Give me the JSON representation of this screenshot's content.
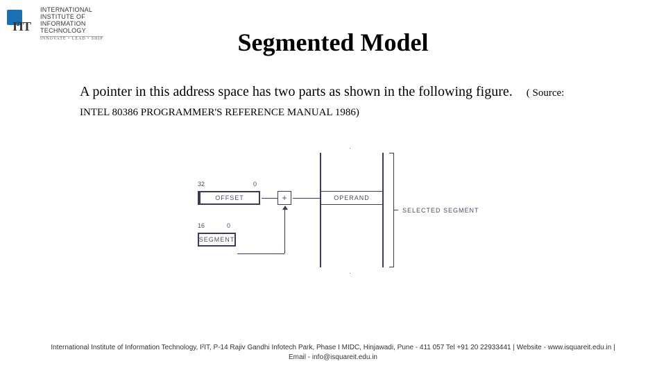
{
  "logo": {
    "line1": "International",
    "line2": "Institute of",
    "line3": "Information",
    "line4": "Technology",
    "tagline": "Innovate • Lead • Ship"
  },
  "title": "Segmented Model",
  "body": {
    "sentence": "A  pointer in this address space  has  two parts as shown in the following figure.",
    "source": "( Source: INTEL 80386 PROGRAMMER'S REFERENCE MANUAL 1986)"
  },
  "diagram": {
    "offset": {
      "bit_high": "32",
      "bit_low": "0",
      "label": "OFFSET"
    },
    "segment": {
      "bit_high": "16",
      "bit_low": "0",
      "label": "SEGMENT"
    },
    "adder": "+",
    "operand": "OPERAND",
    "selected_segment": "SELECTED SEGMENT"
  },
  "footer": {
    "line1": "International Institute of Information Technology, I²IT, P-14 Rajiv Gandhi Infotech Park, Phase I MIDC, Hinjawadi, Pune - 411 057 Tel +91 20 22933441 | Website - www.isquareit.edu.in |",
    "line2": "Email - info@isquareit.edu.in"
  }
}
